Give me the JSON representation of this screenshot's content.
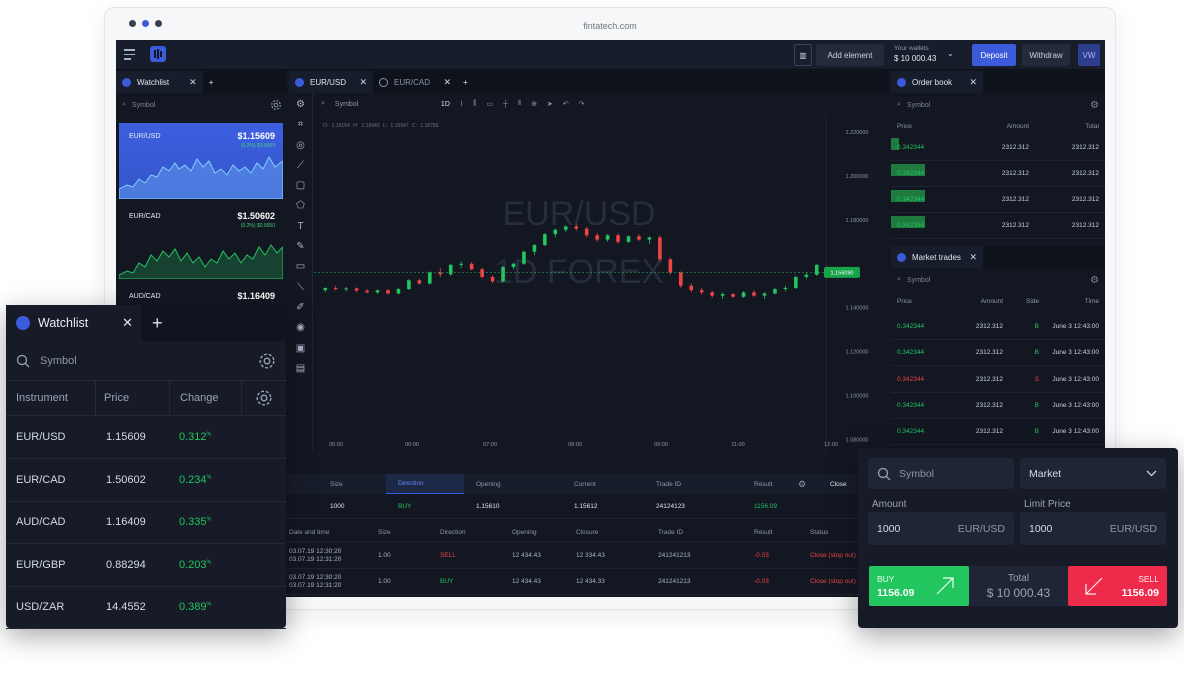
{
  "browser": {
    "url": "fintatech.com"
  },
  "topbar": {
    "add_element": "Add element",
    "wallets_label": "Your wallets",
    "wallets_value": "$ 10 000.43",
    "deposit": "Deposit",
    "withdraw": "Withdraw",
    "avatar": "VW"
  },
  "watchlist_mini": {
    "tab": "Watchlist",
    "search": "Symbol",
    "cards": [
      {
        "name": "EUR/USD",
        "price": "$1.15609",
        "change": "(0.2%) $0.0009"
      },
      {
        "name": "EUR/CAD",
        "price": "$1.50602",
        "change": "(0.2%) $0.0050"
      },
      {
        "name": "AUD/CAD",
        "price": "$1.16409"
      }
    ]
  },
  "chart_tabs": [
    {
      "label": "EUR/USD"
    },
    {
      "label": "EUR/CAD"
    }
  ],
  "chart_toolbar": {
    "search": "Symbol",
    "interval": "1D"
  },
  "chart": {
    "ohlc": "O: 1.16154   H: 1.16940   L: 1.15947   C: 1.16783",
    "watermark1": "EUR/USD",
    "watermark2": "1D FOREX",
    "last_price": "1.156090",
    "y_ticks": [
      "1.220000",
      "1.200000",
      "1.180000",
      "1.140000",
      "1.120000",
      "1.100000",
      "1.080000"
    ],
    "x_ticks": [
      "05:00",
      "06:00",
      "07:00",
      "08:00",
      "09:00",
      "11:00",
      "12:00"
    ]
  },
  "chart_data": {
    "type": "candlestick",
    "y_axis_labels": [
      "1.220000",
      "1.200000",
      "1.180000",
      "1.140000",
      "1.120000",
      "1.100000",
      "1.080000"
    ],
    "x_axis_labels": [
      "05:00",
      "06:00",
      "07:00",
      "08:00",
      "09:00",
      "11:00",
      "12:00"
    ],
    "current_price": 1.15609,
    "candles": [
      [
        1.148,
        1.1492,
        1.147,
        1.149
      ],
      [
        1.149,
        1.15,
        1.1478,
        1.1485
      ],
      [
        1.1485,
        1.1495,
        1.1475,
        1.1488
      ],
      [
        1.1488,
        1.1492,
        1.147,
        1.1478
      ],
      [
        1.1478,
        1.1485,
        1.1465,
        1.147
      ],
      [
        1.147,
        1.1482,
        1.1462,
        1.148
      ],
      [
        1.148,
        1.1485,
        1.146,
        1.1465
      ],
      [
        1.1465,
        1.149,
        1.146,
        1.1485
      ],
      [
        1.1485,
        1.153,
        1.148,
        1.1525
      ],
      [
        1.1525,
        1.1532,
        1.1505,
        1.151
      ],
      [
        1.151,
        1.1565,
        1.1505,
        1.156
      ],
      [
        1.156,
        1.158,
        1.154,
        1.1552
      ],
      [
        1.1552,
        1.16,
        1.1545,
        1.1595
      ],
      [
        1.1595,
        1.161,
        1.158,
        1.16
      ],
      [
        1.16,
        1.1608,
        1.157,
        1.1575
      ],
      [
        1.1575,
        1.1582,
        1.1535,
        1.154
      ],
      [
        1.154,
        1.1548,
        1.151,
        1.152
      ],
      [
        1.152,
        1.159,
        1.1515,
        1.1585
      ],
      [
        1.1585,
        1.1605,
        1.1575,
        1.16
      ],
      [
        1.16,
        1.166,
        1.1595,
        1.1655
      ],
      [
        1.1655,
        1.169,
        1.164,
        1.1685
      ],
      [
        1.1685,
        1.174,
        1.168,
        1.1735
      ],
      [
        1.1735,
        1.176,
        1.172,
        1.1755
      ],
      [
        1.1755,
        1.1775,
        1.1745,
        1.177
      ],
      [
        1.177,
        1.178,
        1.175,
        1.176
      ],
      [
        1.176,
        1.1768,
        1.172,
        1.173
      ],
      [
        1.173,
        1.174,
        1.17,
        1.171
      ],
      [
        1.171,
        1.1735,
        1.17,
        1.173
      ],
      [
        1.173,
        1.1738,
        1.169,
        1.17
      ],
      [
        1.17,
        1.173,
        1.1695,
        1.1725
      ],
      [
        1.1725,
        1.1735,
        1.1705,
        1.171
      ],
      [
        1.171,
        1.1725,
        1.169,
        1.172
      ],
      [
        1.172,
        1.1728,
        1.161,
        1.162
      ],
      [
        1.162,
        1.1628,
        1.155,
        1.156
      ],
      [
        1.156,
        1.1565,
        1.149,
        1.15
      ],
      [
        1.15,
        1.151,
        1.147,
        1.148
      ],
      [
        1.148,
        1.149,
        1.146,
        1.147
      ],
      [
        1.147,
        1.1478,
        1.1445,
        1.1455
      ],
      [
        1.1455,
        1.147,
        1.144,
        1.1462
      ],
      [
        1.1462,
        1.1468,
        1.1445,
        1.145
      ],
      [
        1.145,
        1.1475,
        1.1445,
        1.147
      ],
      [
        1.147,
        1.148,
        1.145,
        1.1455
      ],
      [
        1.1455,
        1.147,
        1.144,
        1.1465
      ],
      [
        1.1465,
        1.149,
        1.146,
        1.1485
      ],
      [
        1.1485,
        1.15,
        1.1475,
        1.149
      ],
      [
        1.149,
        1.1545,
        1.1485,
        1.154
      ],
      [
        1.154,
        1.156,
        1.153,
        1.155
      ],
      [
        1.155,
        1.16,
        1.1545,
        1.1595
      ]
    ]
  },
  "orders_top": {
    "headers": [
      "Size",
      "Direction",
      "Opening",
      "Current",
      "Trade ID",
      "Result"
    ],
    "row": [
      "1000",
      "BUY",
      "1.15610",
      "1.15612",
      "24124123",
      "1156.09"
    ],
    "close": "Close"
  },
  "orders_hist": {
    "headers": [
      "Date and time",
      "Size",
      "Direction",
      "Opening",
      "Closure",
      "Trade ID",
      "Result",
      "Status"
    ],
    "rows": [
      {
        "date1": "03.07.19 12:30:20",
        "date2": "03.07.19 12:31:20",
        "size": "1.00",
        "dir": "SELL",
        "open": "12 434.43",
        "close": "12 334.43",
        "id": "241241213",
        "result": "-0.03",
        "status": "Close (stop out)"
      },
      {
        "date1": "03.07.19 12:30:20",
        "date2": "03.07.19 12:31:20",
        "size": "1.00",
        "dir": "BUY",
        "open": "12 434.43",
        "close": "12 434.33",
        "id": "241241213",
        "result": "-0.03",
        "status": "Close (stop out)"
      }
    ]
  },
  "order_book": {
    "tab": "Order book",
    "search": "Symbol",
    "headers": [
      "Price",
      "Amount",
      "Total"
    ],
    "rows": [
      [
        "0.342344",
        "2312.312",
        "2312.312"
      ],
      [
        "0.342344",
        "2312.312",
        "2312.312"
      ],
      [
        "0.342344",
        "2312.312",
        "2312.312"
      ],
      [
        "0.342344",
        "2312.312",
        "2312.312"
      ]
    ]
  },
  "market_trades": {
    "tab": "Market trades",
    "search": "Symbol",
    "headers": [
      "Price",
      "Amount",
      "Side",
      "Time"
    ],
    "rows": [
      {
        "price": "0.342344",
        "amount": "2312.312",
        "side": "B",
        "time": "June 3 12:43:00"
      },
      {
        "price": "0.342344",
        "amount": "2312.312",
        "side": "B",
        "time": "June 3 12:43:00"
      },
      {
        "price": "0.342344",
        "amount": "2312.312",
        "side": "S",
        "time": "June 3 12:43:00"
      },
      {
        "price": "0.342344",
        "amount": "2312.312",
        "side": "B",
        "time": "June 3 12:43:00"
      },
      {
        "price": "0.342344",
        "amount": "2312.312",
        "side": "B",
        "time": "June 3 12:43:00"
      }
    ]
  },
  "watchlist_panel": {
    "title": "Watchlist",
    "search": "Symbol",
    "headers": [
      "Instrument",
      "Price",
      "Change"
    ],
    "rows": [
      {
        "instrument": "EUR/USD",
        "price": "1.15609",
        "change": "0.312",
        "pct": "%"
      },
      {
        "instrument": "EUR/CAD",
        "price": "1.50602",
        "change": "0.234",
        "pct": "%"
      },
      {
        "instrument": "AUD/CAD",
        "price": "1.16409",
        "change": "0.335",
        "pct": "%"
      },
      {
        "instrument": "EUR/GBP",
        "price": "0.88294",
        "change": "0.203",
        "pct": "%"
      },
      {
        "instrument": "USD/ZAR",
        "price": "14.4552",
        "change": "0.389",
        "pct": "%"
      }
    ]
  },
  "order_panel": {
    "search": "Symbol",
    "type": "Market",
    "amount_label": "Amount",
    "limit_label": "Limit Price",
    "amount": "1000",
    "amount_unit": "EUR/USD",
    "limit": "1000",
    "limit_unit": "EUR/USD",
    "buy_label": "BUY",
    "buy_price": "1156.09",
    "total_label": "Total",
    "total_value": "$ 10 000.43",
    "sell_label": "SELL",
    "sell_price": "1156.09"
  },
  "colors": {
    "bg": "#131722",
    "accent": "#3b5bdb",
    "green": "#22c55e",
    "red": "#ef4444"
  }
}
